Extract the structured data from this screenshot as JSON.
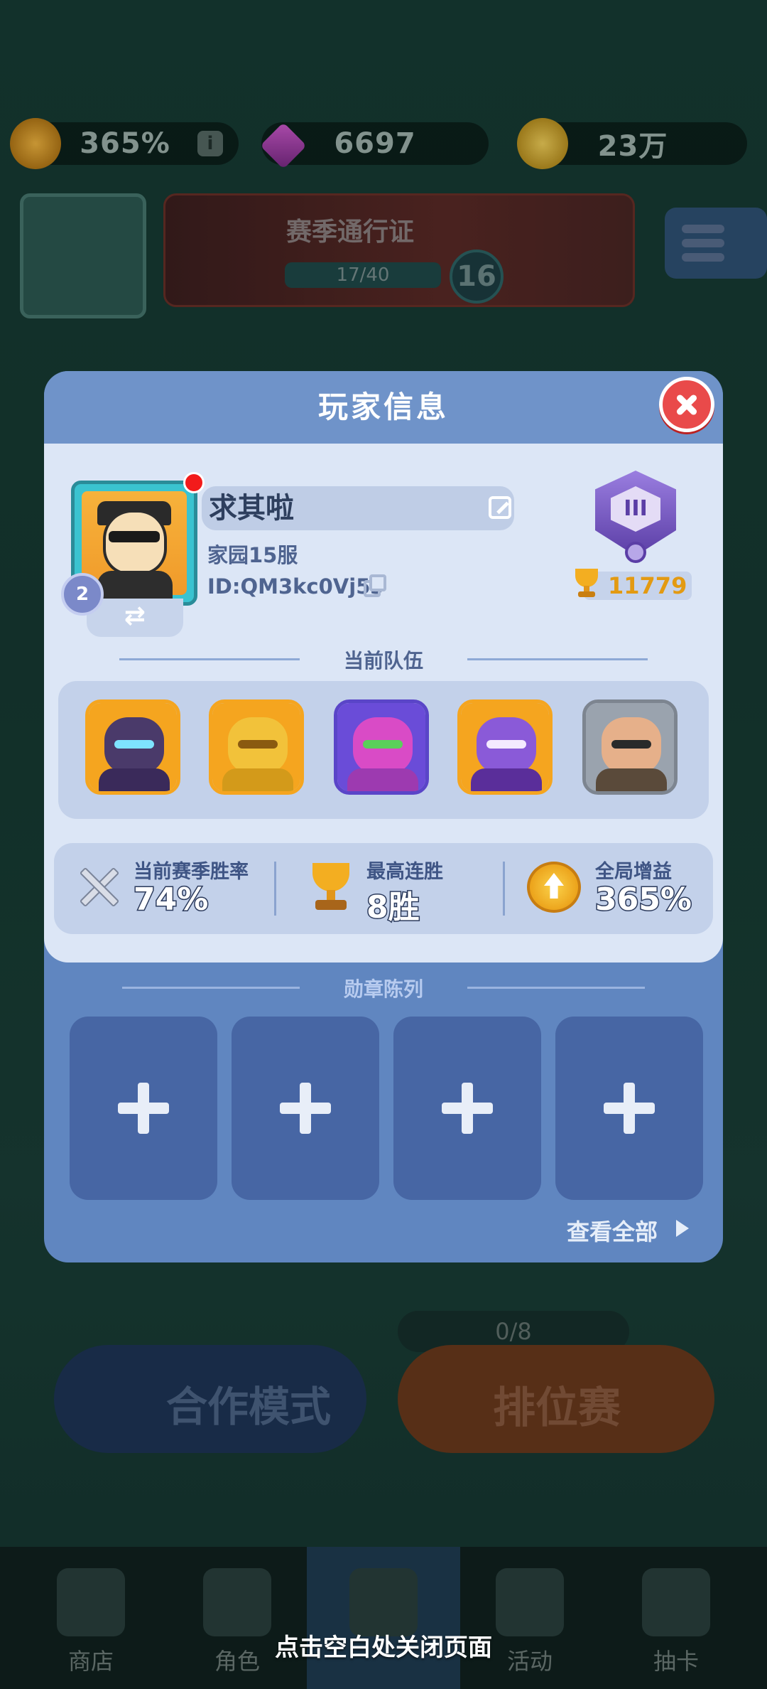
{
  "background": {
    "resources": {
      "boost": "365%",
      "gems": "6697",
      "coins": "23万"
    },
    "season_pass": {
      "title": "赛季通行证",
      "progress": "17/40",
      "level": "16"
    },
    "ticket_count": "0/8",
    "coop_mode": "合作模式",
    "ranked_mode": "排位赛",
    "nav": [
      {
        "label": "商店"
      },
      {
        "label": "角色"
      },
      {
        "label": ""
      },
      {
        "label": "活动"
      },
      {
        "label": "抽卡"
      }
    ]
  },
  "modal": {
    "title": "玩家信息",
    "player": {
      "name": "求其啦",
      "server": "家园15服",
      "id": "ID:QM3kc0Vj5s",
      "avatar_level": "2",
      "rank_roman": "III",
      "trophies": "11779"
    },
    "team_title": "当前队伍",
    "team": [
      {
        "icon": "dark-knight-hero-icon",
        "bg": "#f5a51f",
        "head": "#4a3a6a",
        "eyes": "#7ee3ff",
        "body": "#3a2a5a"
      },
      {
        "icon": "golden-warrior-hero-icon",
        "bg": "#f5a51f",
        "head": "#f2c23a",
        "eyes": "#8a5a10",
        "body": "#d39a1a"
      },
      {
        "icon": "pink-brute-hero-icon",
        "bg": "#6a4cd8",
        "head": "#d94bc6",
        "eyes": "#5ad05a",
        "body": "#9d3ab0"
      },
      {
        "icon": "purple-mage-hero-icon",
        "bg": "#f5a51f",
        "head": "#8a5ad8",
        "eyes": "#f4eaff",
        "body": "#5a2e9a"
      },
      {
        "icon": "brawler-hero-icon",
        "bg": "#9aa3ae",
        "head": "#e6b08a",
        "eyes": "#2a2a2a",
        "body": "#5a4a3a"
      }
    ],
    "stats": [
      {
        "label": "当前赛季胜率",
        "value": "74%",
        "icon": "crossed-swords-icon"
      },
      {
        "label": "最高连胜",
        "value": "8胜",
        "icon": "trophy-icon"
      },
      {
        "label": "全局增益",
        "value": "365%",
        "icon": "boost-icon"
      }
    ],
    "medal_title": "勋章陈列",
    "medal_slots": 4,
    "view_all": "查看全部"
  },
  "hint": "点击空白处关闭页面"
}
